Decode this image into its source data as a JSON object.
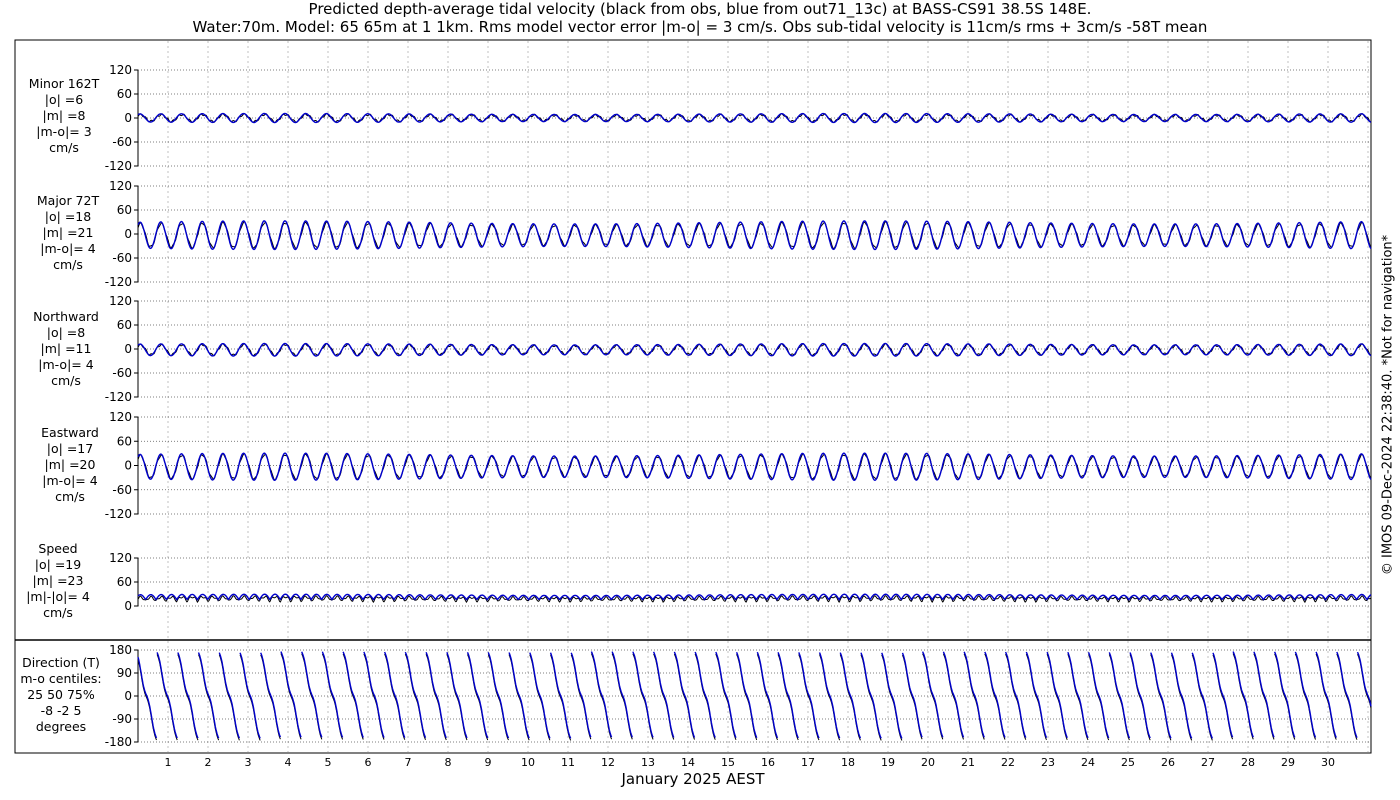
{
  "title": {
    "line1": "Predicted depth-average tidal velocity (black from obs, blue from out71_13c) at BASS-CS91 38.5S 148E.",
    "line2": "Water:70m. Model: 65 65m at 1 1km. Rms model vector error |m-o| = 3 cm/s. Obs sub-tidal velocity is 11cm/s rms + 3cm/s -58T mean"
  },
  "credit": "© IMOS 09-Dec-2024 22:38:40. *Not for navigation*",
  "xlabel": "January 2025 AEST",
  "x_ticks": [
    "1",
    "2",
    "3",
    "4",
    "5",
    "6",
    "7",
    "8",
    "9",
    "10",
    "11",
    "12",
    "13",
    "14",
    "15",
    "16",
    "17",
    "18",
    "19",
    "20",
    "21",
    "22",
    "23",
    "24",
    "25",
    "26",
    "27",
    "28",
    "29",
    "30"
  ],
  "colors": {
    "obs": "#000000",
    "model": "#0000cc",
    "grid": "#555555"
  },
  "chart_data": [
    {
      "type": "line",
      "panel": "minor",
      "label_lines": [
        "Minor 162T",
        "|o| =6",
        "|m| =8",
        "|m-o|= 3",
        "cm/s"
      ],
      "ylim": [
        -120,
        120
      ],
      "yticks": [
        "120",
        "60",
        "0",
        "-60",
        "-120"
      ],
      "series": [
        {
          "amplitude": 8,
          "offset": 0
        },
        {
          "amplitude": 10,
          "offset": 0
        }
      ]
    },
    {
      "type": "line",
      "panel": "major",
      "label_lines": [
        "Major 72T",
        "|o| =18",
        "|m| =21",
        "|m-o|= 4",
        "cm/s"
      ],
      "ylim": [
        -120,
        120
      ],
      "yticks": [
        "120",
        "60",
        "0",
        "-60",
        "-120"
      ],
      "series": [
        {
          "amplitude": 28,
          "offset": -3
        },
        {
          "amplitude": 32,
          "offset": -3
        }
      ]
    },
    {
      "type": "line",
      "panel": "northward",
      "label_lines": [
        "Northward",
        "|o| =8",
        "|m| =11",
        "|m-o|= 4",
        "cm/s"
      ],
      "ylim": [
        -120,
        120
      ],
      "yticks": [
        "120",
        "60",
        "0",
        "-60",
        "-120"
      ],
      "series": [
        {
          "amplitude": 12,
          "offset": -2
        },
        {
          "amplitude": 14,
          "offset": -2
        }
      ]
    },
    {
      "type": "line",
      "panel": "eastward",
      "label_lines": [
        "Eastward",
        "|o| =17",
        "|m| =20",
        "|m-o|= 4",
        "cm/s"
      ],
      "ylim": [
        -120,
        120
      ],
      "yticks": [
        "120",
        "60",
        "0",
        "-60",
        "-120"
      ],
      "series": [
        {
          "amplitude": 27,
          "offset": -3
        },
        {
          "amplitude": 30,
          "offset": -3
        }
      ]
    },
    {
      "type": "line",
      "panel": "speed",
      "label_lines": [
        "Speed",
        "|o| =19",
        "|m| =23",
        "|m|-|o|= 4",
        "cm/s"
      ],
      "ylim": [
        0,
        120
      ],
      "yticks": [
        "120",
        "60",
        "0"
      ],
      "series": [
        {
          "amplitude": 10,
          "offset": 18
        },
        {
          "amplitude": 12,
          "offset": 22
        }
      ]
    },
    {
      "type": "line",
      "panel": "direction",
      "label_lines": [
        "Direction (T)",
        "m-o centiles:",
        "25  50  75%",
        "-8 -2  5",
        "degrees"
      ],
      "ylim": [
        -180,
        180
      ],
      "yticks": [
        "180",
        "90",
        "0",
        "-90",
        "-180"
      ],
      "series": [
        {
          "kind": "sawtooth"
        },
        {
          "kind": "sawtooth"
        }
      ]
    }
  ]
}
